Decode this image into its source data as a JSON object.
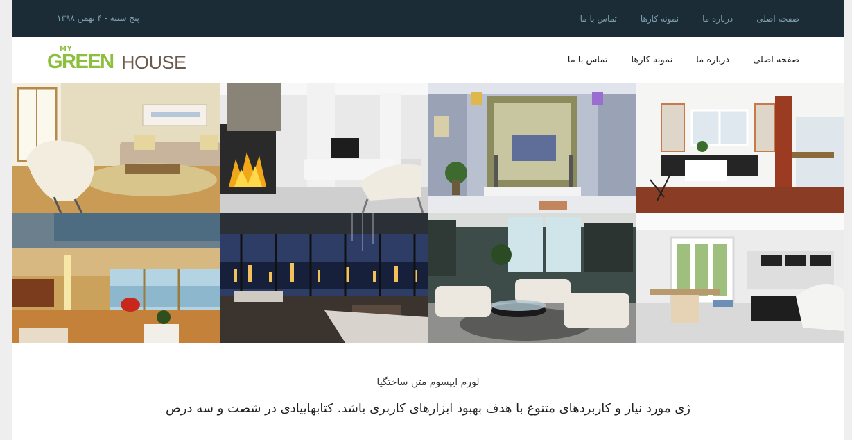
{
  "topbar": {
    "date": "پنج شنبه - ۴ بهمن ۱۳۹۸",
    "nav": [
      "صفحه اصلی",
      "درباره ما",
      "نمونه کارها",
      "تماس با ما"
    ]
  },
  "header": {
    "logo": {
      "my": "MY",
      "green": "GREEN",
      "house": "HOUSE"
    },
    "nav": [
      "صفحه اصلی",
      "درباره ما",
      "نمونه کارها",
      "تماس با ما"
    ]
  },
  "gallery": {
    "images": [
      "living-room-image",
      "fireplace-room-image",
      "tv-wall-room-image",
      "bright-living-room-image",
      "ocean-view-loft-image",
      "city-night-view-room-image",
      "white-sofa-room-image",
      "white-lounge-room-image"
    ]
  },
  "content": {
    "subtitle": "لورم ایپسوم متن ساختگیا",
    "lead": "ژی مورد نیاز و کاربردهای متنوع با هدف بهبود ابزارهای کاربری باشد. کتابهاییادی در شصت و سه درص"
  },
  "colors": {
    "topbar": "#1c2c37",
    "topbar_text": "#7e9fae",
    "brand_green": "#8bbf3c",
    "brand_brown": "#6b5a4c"
  }
}
